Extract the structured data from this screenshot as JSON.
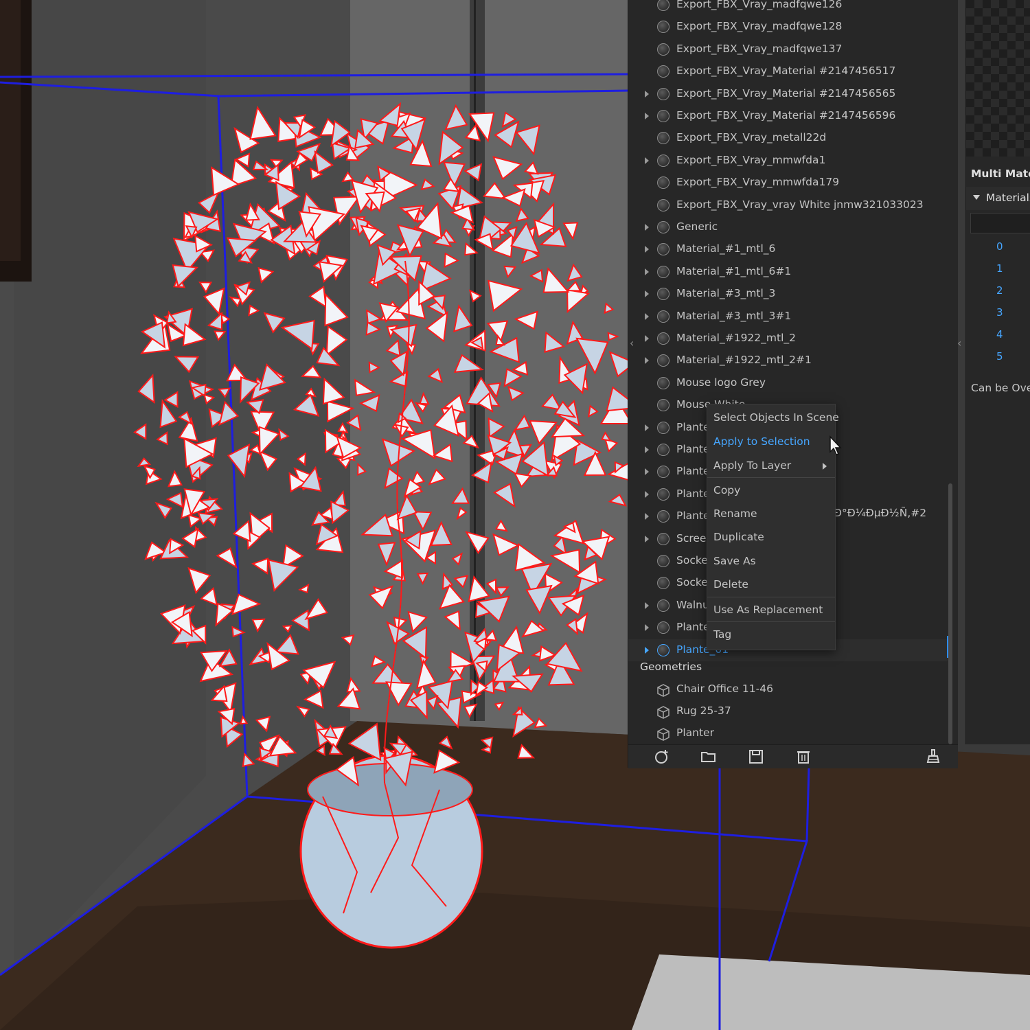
{
  "material_list": {
    "items": [
      {
        "label": "Export_FBX_Vray_madfqwe126",
        "expand": false
      },
      {
        "label": "Export_FBX_Vray_madfqwe128",
        "expand": false
      },
      {
        "label": "Export_FBX_Vray_madfqwe137",
        "expand": false
      },
      {
        "label": "Export_FBX_Vray_Material #2147456517",
        "expand": false
      },
      {
        "label": "Export_FBX_Vray_Material #2147456565",
        "expand": true
      },
      {
        "label": "Export_FBX_Vray_Material #2147456596",
        "expand": true
      },
      {
        "label": "Export_FBX_Vray_metall22d",
        "expand": false
      },
      {
        "label": "Export_FBX_Vray_mmwfda1",
        "expand": true
      },
      {
        "label": "Export_FBX_Vray_mmwfda179",
        "expand": false
      },
      {
        "label": "Export_FBX_Vray_vray White jnmw321033023",
        "expand": false
      },
      {
        "label": "Generic",
        "expand": true
      },
      {
        "label": "Material_#1_mtl_6",
        "expand": true
      },
      {
        "label": "Material_#1_mtl_6#1",
        "expand": true
      },
      {
        "label": "Material_#3_mtl_3",
        "expand": true
      },
      {
        "label": "Material_#3_mtl_3#1",
        "expand": true
      },
      {
        "label": "Material_#1922_mtl_2",
        "expand": true
      },
      {
        "label": "Material_#1922_mtl_2#1",
        "expand": true
      },
      {
        "label": "Mouse logo Grey",
        "expand": false
      },
      {
        "label": "Mouse White",
        "expand": false
      },
      {
        "label": "Plante",
        "expand": true
      },
      {
        "label": "Plante",
        "expand": true
      },
      {
        "label": "Plante",
        "expand": true
      },
      {
        "label": "Plante",
        "expand": true
      },
      {
        "label": "Plante",
        "expand": true
      },
      {
        "label": "Screen",
        "expand": true
      },
      {
        "label": "Socket",
        "expand": false
      },
      {
        "label": "Socket",
        "expand": false
      },
      {
        "label": "Walnu",
        "expand": true
      },
      {
        "label": "Plante",
        "expand": true
      },
      {
        "label": "Plante_01",
        "expand": true,
        "selected": true
      }
    ],
    "overflow_text": "Ð°Ð¼ÐµÐ½Ñ‚#2"
  },
  "geometries": {
    "header": "Geometries",
    "items": [
      {
        "label": "Chair Office 11-46"
      },
      {
        "label": "Rug 25-37"
      },
      {
        "label": "Planter"
      }
    ]
  },
  "context_menu": {
    "items": [
      {
        "label": "Select Objects In Scene"
      },
      {
        "label": "Apply to Selection",
        "highlighted": true
      },
      {
        "label": "Apply To Layer",
        "submenu": true
      },
      {
        "label": "Copy"
      },
      {
        "label": "Rename"
      },
      {
        "label": "Duplicate"
      },
      {
        "label": "Save As"
      },
      {
        "label": "Delete"
      },
      {
        "label": "Use As Replacement"
      },
      {
        "label": "Tag"
      }
    ]
  },
  "toolbar": {
    "icons": [
      "add-material-icon",
      "open-folder-icon",
      "save-icon",
      "delete-icon",
      "purge-broom-icon"
    ]
  },
  "multi_material": {
    "title": "Multi Materi",
    "section": "Materials",
    "indices": [
      "0",
      "1",
      "2",
      "3",
      "4",
      "5"
    ],
    "footer": "Can be Over"
  },
  "colors": {
    "accent": "#46a6ff",
    "panel_bg": "#272727",
    "highlight_edge": "#ff1a1a",
    "bounding_box": "#1e1ee0"
  }
}
